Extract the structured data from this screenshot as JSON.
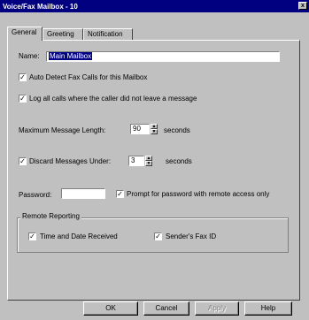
{
  "window": {
    "title": "Voice/Fax Mailbox - 10",
    "close_glyph": "x"
  },
  "tabs": [
    {
      "label": "General",
      "active": true
    },
    {
      "label": "Greeting",
      "active": false
    },
    {
      "label": "Notification",
      "active": false
    }
  ],
  "name_field": {
    "label": "Name:",
    "value": "Main Mailbox"
  },
  "auto_detect": {
    "label": "Auto Detect Fax Calls for this Mailbox",
    "checked": true
  },
  "log_calls": {
    "label": "Log all calls where the caller did not leave a message",
    "checked": true
  },
  "max_length": {
    "label": "Maximum Message Length:",
    "value": "90",
    "unit": "seconds"
  },
  "discard": {
    "label": "Discard Messages Under:",
    "value": "3",
    "unit": "seconds",
    "checked": true
  },
  "password": {
    "label": "Password:",
    "value": ""
  },
  "prompt_password": {
    "label": "Prompt for password with remote access only",
    "checked": true
  },
  "remote_reporting": {
    "title": "Remote Reporting",
    "time_date": {
      "label": "Time and Date Received",
      "checked": true
    },
    "sender_fax": {
      "label": "Sender's Fax ID",
      "checked": true
    }
  },
  "buttons": {
    "ok": "OK",
    "cancel": "Cancel",
    "apply": "Apply",
    "help": "Help"
  },
  "check_glyph": "✓",
  "spin_up": "▲",
  "spin_down": "▼"
}
